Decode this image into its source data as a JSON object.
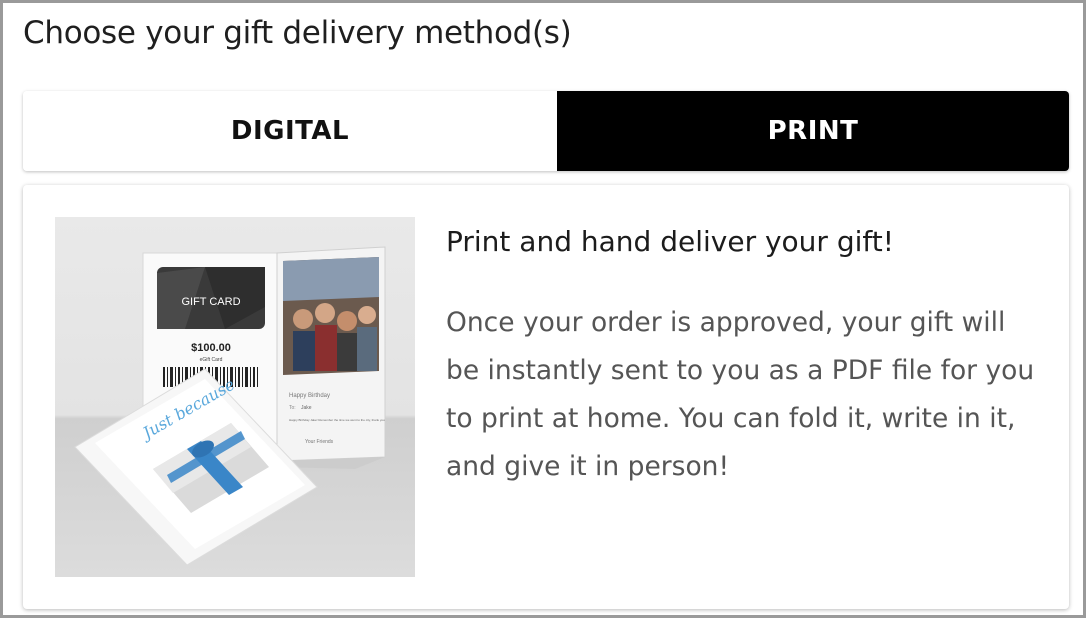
{
  "heading": "Choose your gift delivery method(s)",
  "tabs": [
    {
      "label": "DIGITAL",
      "selected": false
    },
    {
      "label": "PRINT",
      "selected": true
    }
  ],
  "panel": {
    "title": "Print and hand deliver your gift!",
    "body": "Once your order is approved, your gift will be instantly sent to you as a PDF file for you to print at home. You can fold it, write in it, and give it in person!"
  },
  "illustration": {
    "gift_card_label": "GIFT CARD",
    "amount": "$100.00",
    "card_type": "eGift Card",
    "greeting": "Happy Birthday",
    "to_label": "To:",
    "to_name": "Jake",
    "message": "Happy Birthday Jake! Remember the time we went to the city, thank you",
    "from_label": "Your Friends",
    "envelope_text": "Just because"
  },
  "colors": {
    "selected_tab_bg": "#000000",
    "unselected_tab_bg": "#ffffff",
    "ribbon": "#3a86c8"
  }
}
